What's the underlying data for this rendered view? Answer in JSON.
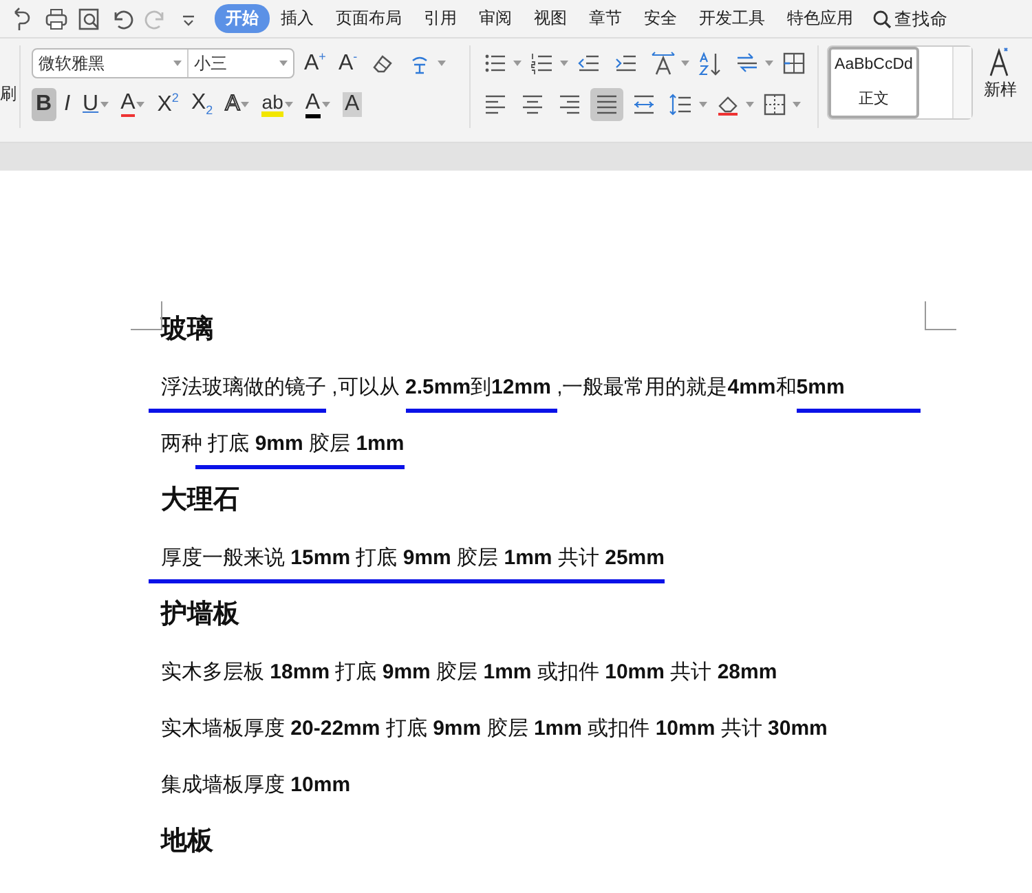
{
  "quick_access": [
    {
      "kind": "revert"
    },
    {
      "kind": "print"
    },
    {
      "kind": "preview"
    },
    {
      "kind": "undo",
      "disabled": false
    },
    {
      "kind": "redo",
      "disabled": true
    },
    {
      "kind": "caret"
    }
  ],
  "tabs": [
    {
      "label": "开始",
      "selected": true
    },
    {
      "label": "插入",
      "selected": false
    },
    {
      "label": "页面布局",
      "selected": false
    },
    {
      "label": "引用",
      "selected": false
    },
    {
      "label": "审阅",
      "selected": false
    },
    {
      "label": "视图",
      "selected": false
    },
    {
      "label": "章节",
      "selected": false
    },
    {
      "label": "安全",
      "selected": false
    },
    {
      "label": "开发工具",
      "selected": false
    },
    {
      "label": "特色应用",
      "selected": false
    }
  ],
  "search": {
    "placeholder": "查找命"
  },
  "clipboard": {
    "label": "刷"
  },
  "font": {
    "name": "微软雅黑",
    "size": "小三",
    "row1": [
      {
        "kind": "glyph",
        "text": "A$^{+}$"
      },
      {
        "kind": "glyph",
        "text": "A$^{-}$"
      },
      {
        "kind": "eraser"
      },
      {
        "kind": "pinyin"
      }
    ],
    "row2": [
      {
        "kind": "bold",
        "text": "B",
        "active": true
      },
      {
        "kind": "italic",
        "text": "I",
        "active": false
      },
      {
        "kind": "underline",
        "text": "U",
        "caret": true,
        "active": false
      },
      {
        "kind": "strike",
        "text": "A",
        "caret": true,
        "active": false
      },
      {
        "kind": "glyph",
        "text": "X$^{2}$",
        "active": false
      },
      {
        "kind": "glyph",
        "text": "X$_{2}$",
        "active": false
      },
      {
        "kind": "outline",
        "text": "A",
        "caret": true,
        "active": false
      },
      {
        "kind": "highlight",
        "text": "ab",
        "caret": true,
        "active": false
      },
      {
        "kind": "color-bar",
        "text": "A",
        "caret": true,
        "active": false
      },
      {
        "kind": "shaded",
        "text": "A",
        "active": false
      }
    ]
  },
  "paragraph": {
    "row1": [
      {
        "kind": "bullets",
        "active": false
      },
      {
        "kind": "numbering",
        "active": false
      },
      {
        "kind": "outdent",
        "active": false
      },
      {
        "kind": "indent",
        "active": false
      },
      {
        "kind": "text-direction",
        "active": false
      },
      {
        "kind": "sort",
        "active": false
      },
      {
        "kind": "swap",
        "active": false
      },
      {
        "kind": "table",
        "active": false
      }
    ],
    "row2": [
      {
        "kind": "align-left",
        "active": false
      },
      {
        "kind": "align-center",
        "active": false
      },
      {
        "kind": "align-right",
        "active": false
      },
      {
        "kind": "justify",
        "active": true
      },
      {
        "kind": "distribute",
        "active": false
      },
      {
        "kind": "line-spacing",
        "active": false
      },
      {
        "kind": "shading",
        "active": false
      },
      {
        "kind": "borders",
        "active": false
      }
    ]
  },
  "styles": {
    "preview": "AaBbCcDd",
    "name": "正文",
    "new_style": "新样"
  },
  "document": [
    {
      "kind": "heading",
      "text": "玻璃"
    },
    {
      "kind": "line",
      "segments": [
        {
          "text": "浮法玻璃做的镜子",
          "underlined": true,
          "lead": true
        },
        {
          "text": " ,可以从 ",
          "underlined": false
        },
        {
          "text": "**2.5mm**到**12mm** ",
          "underlined": true
        },
        {
          "text": ",一般最常用的就是**4mm**和",
          "underlined": false
        },
        {
          "text": "**5mm**",
          "underlined": true,
          "trail": true
        }
      ]
    },
    {
      "kind": "line",
      "segments": [
        {
          "text": "两种 ",
          "underlined": false
        },
        {
          "text": "打底 **9mm** 胶层 **1mm**",
          "underlined": true,
          "lead": true
        }
      ]
    },
    {
      "kind": "heading",
      "text": "大理石"
    },
    {
      "kind": "line",
      "segments": [
        {
          "text": "厚度一般来说 **15mm** 打底 **9mm** 胶层 **1mm** 共计 **25mm**",
          "underlined": true,
          "lead": true
        }
      ]
    },
    {
      "kind": "heading",
      "text": "护墙板"
    },
    {
      "kind": "line",
      "segments": [
        {
          "text": "实木多层板 **18mm** 打底 **9mm** 胶层 **1mm** 或扣件 **10mm** 共计 **28mm**",
          "underlined": false
        }
      ]
    },
    {
      "kind": "line",
      "segments": [
        {
          "text": "实木墙板厚度 **20-22mm** 打底 **9mm** 胶层 **1mm** 或扣件 **10mm** 共计 **30mm**",
          "underlined": false
        }
      ]
    },
    {
      "kind": "line",
      "segments": [
        {
          "text": "集成墙板厚度 **10mm**",
          "underlined": false
        }
      ]
    },
    {
      "kind": "heading",
      "text": "地板"
    }
  ]
}
